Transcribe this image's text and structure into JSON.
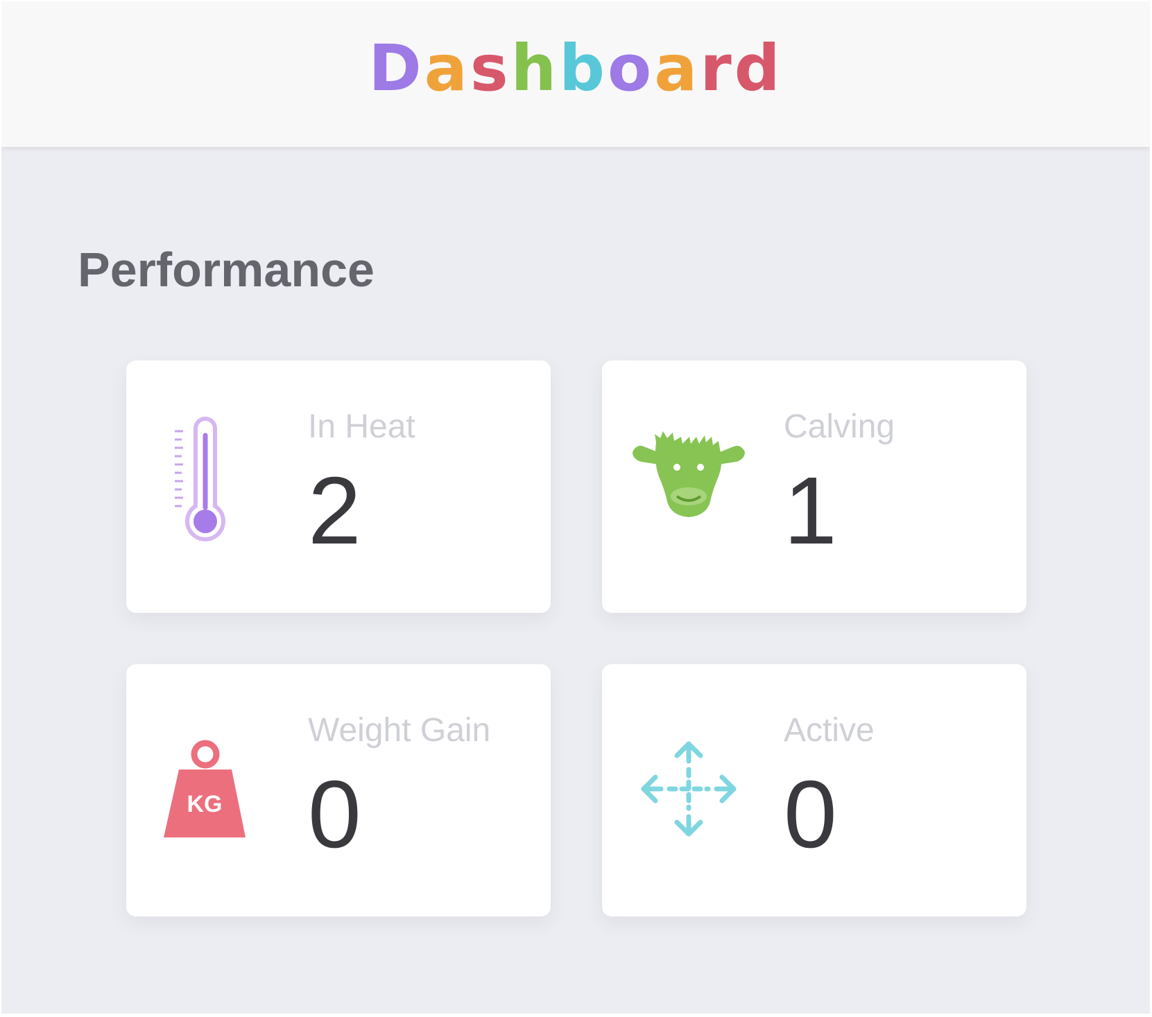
{
  "header": {
    "title": "Dashboard",
    "title_letters": [
      {
        "char": "D",
        "color": "#9d7ae6"
      },
      {
        "char": "a",
        "color": "#f0a23a"
      },
      {
        "char": "s",
        "color": "#d8586b"
      },
      {
        "char": "h",
        "color": "#84c14d"
      },
      {
        "char": "b",
        "color": "#58c7d8"
      },
      {
        "char": "o",
        "color": "#9d7ae6"
      },
      {
        "char": "a",
        "color": "#f0a23a"
      },
      {
        "char": "r",
        "color": "#d8586b"
      },
      {
        "char": "d",
        "color": "#d8586b"
      }
    ]
  },
  "section": {
    "title": "Performance"
  },
  "cards": [
    {
      "label": "In Heat",
      "value": "2",
      "icon": "thermometer-icon",
      "color": "#a77ce8"
    },
    {
      "label": "Calving",
      "value": "1",
      "icon": "cow-head-icon",
      "color": "#87c454"
    },
    {
      "label": "Weight Gain",
      "value": "0",
      "icon": "kg-weight-icon",
      "color": "#ec6f7e",
      "icon_text": "KG"
    },
    {
      "label": "Active",
      "value": "0",
      "icon": "move-arrows-icon",
      "color": "#7fd6e0"
    }
  ]
}
